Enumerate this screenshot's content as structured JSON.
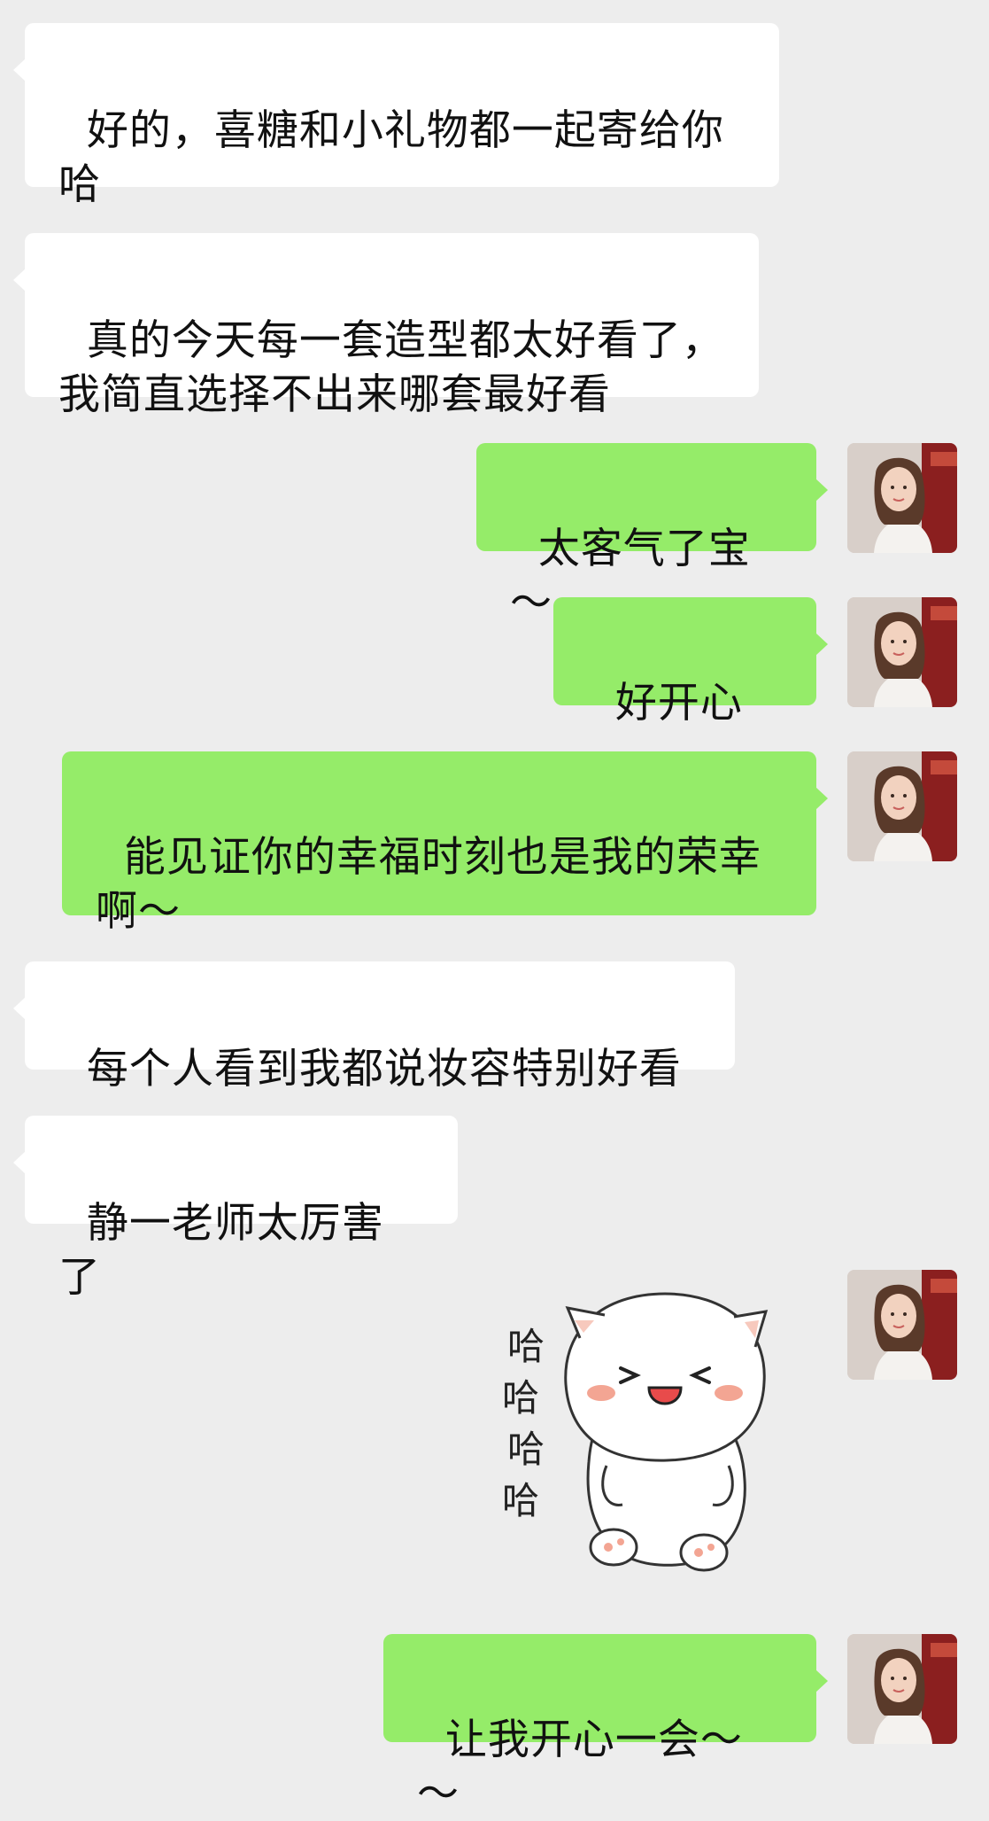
{
  "messages": [
    {
      "side": "incoming",
      "text": "好的，喜糖和小礼物都一起寄给你哈"
    },
    {
      "side": "incoming",
      "text": "真的今天每一套造型都太好看了，我简直选择不出来哪套最好看"
    },
    {
      "side": "outgoing",
      "text": "太客气了宝～"
    },
    {
      "side": "outgoing",
      "text": "好开心",
      "emoji": "partying-face-icon"
    },
    {
      "side": "outgoing",
      "text": "能见证你的幸福时刻也是我的荣幸啊～"
    },
    {
      "side": "incoming",
      "text": "每个人看到我都说妆容特别好看"
    },
    {
      "side": "incoming",
      "text": "静一老师太厉害了"
    },
    {
      "side": "outgoing",
      "type": "sticker",
      "sticker": {
        "description_icon": "laughing-white-cat-sticker",
        "laugh_texts": [
          "哈",
          "哈",
          "哈",
          "哈"
        ]
      }
    },
    {
      "side": "outgoing",
      "text": "让我开心一会～～"
    }
  ],
  "colors": {
    "background": "#ededed",
    "incoming_bubble": "#ffffff",
    "outgoing_bubble": "#95ec69"
  }
}
